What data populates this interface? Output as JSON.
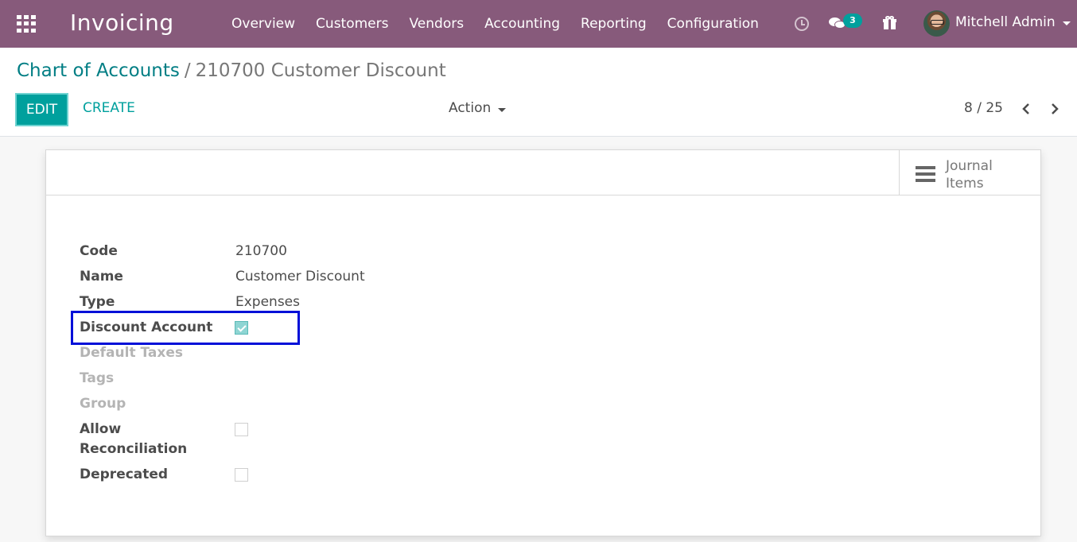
{
  "navbar": {
    "app_title": "Invoicing",
    "menu": [
      "Overview",
      "Customers",
      "Vendors",
      "Accounting",
      "Reporting",
      "Configuration"
    ],
    "chat_badge": "3",
    "user_name": "Mitchell Admin"
  },
  "breadcrumb": {
    "parent": "Chart of Accounts",
    "separator": "/",
    "current": "210700 Customer Discount"
  },
  "toolbar": {
    "edit_label": "EDIT",
    "create_label": "CREATE",
    "action_label": "Action",
    "pager": "8 / 25"
  },
  "stat_button": {
    "label": "Journal Items"
  },
  "fields": {
    "code": {
      "label": "Code",
      "value": "210700"
    },
    "name": {
      "label": "Name",
      "value": "Customer Discount"
    },
    "type": {
      "label": "Type",
      "value": "Expenses"
    },
    "discount_account": {
      "label": "Discount Account",
      "checked": true
    },
    "default_taxes": {
      "label": "Default Taxes"
    },
    "tags": {
      "label": "Tags"
    },
    "group": {
      "label": "Group"
    },
    "allow_reconciliation": {
      "label_line1": "Allow",
      "label_line2": "Reconciliation",
      "checked": false
    },
    "deprecated": {
      "label": "Deprecated",
      "checked": false
    }
  },
  "colors": {
    "navbar": "#875a7b",
    "primary": "#00a09d",
    "link": "#017e84",
    "highlight": "#0010d8"
  }
}
